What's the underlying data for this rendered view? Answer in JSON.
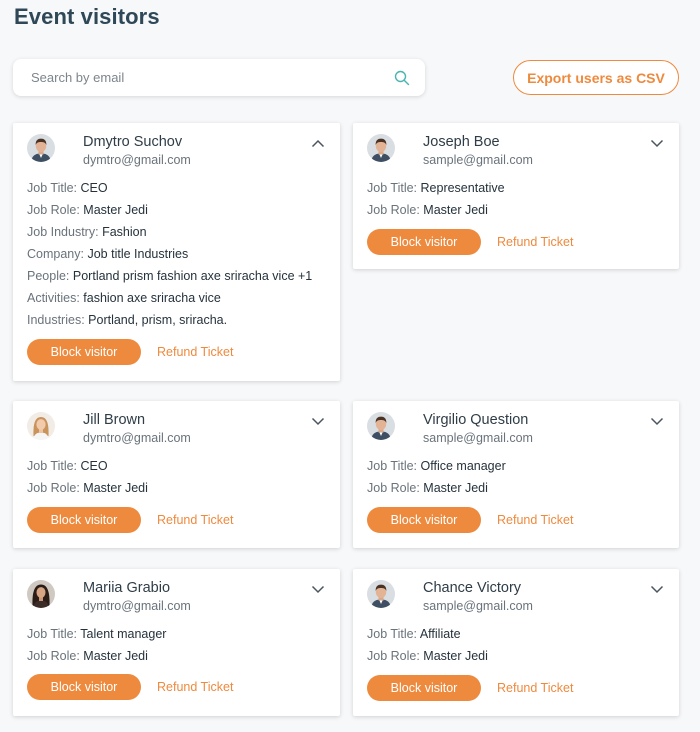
{
  "title": "Event visitors",
  "search": {
    "placeholder": "Search by email",
    "value": ""
  },
  "export_label": "Export users as CSV",
  "colors": {
    "accent": "#ee8a3e",
    "title": "#2f4858",
    "search_icon": "#4ab5b0"
  },
  "labels": {
    "job_title": "Job Title:",
    "job_role": "Job Role:",
    "job_industry": "Job Industry:",
    "company": "Company:",
    "people": "People:",
    "activities": "Activities:",
    "industries": "Industries:",
    "block": "Block visitor",
    "refund": "Refund Ticket"
  },
  "visitors": [
    {
      "name": "Dmytro Suchov",
      "email": "dymtro@gmail.com",
      "expanded": true,
      "avatar": "male-avatar-icon",
      "job_title": "CEO",
      "job_role": "Master Jedi",
      "job_industry": "Fashion",
      "company": "Job title Industries",
      "people": "Portland prism fashion axe sriracha vice +1",
      "activities": "fashion axe sriracha vice",
      "industries": "Portland, prism, sriracha."
    },
    {
      "name": "Joseph Boe",
      "email": "sample@gmail.com",
      "expanded": false,
      "avatar": "male-avatar-icon",
      "job_title": "Representative",
      "job_role": "Master Jedi"
    },
    {
      "name": "Jill Brown",
      "email": "dymtro@gmail.com",
      "expanded": false,
      "avatar": "female-avatar-icon",
      "job_title": "CEO",
      "job_role": "Master Jedi"
    },
    {
      "name": "Virgilio Question",
      "email": "sample@gmail.com",
      "expanded": false,
      "avatar": "male-avatar-icon",
      "job_title": "Office manager",
      "job_role": "Master Jedi"
    },
    {
      "name": "Mariia Grabio",
      "email": "dymtro@gmail.com",
      "expanded": false,
      "avatar": "female-avatar-icon",
      "job_title": "Talent manager",
      "job_role": "Master Jedi"
    },
    {
      "name": "Chance Victory",
      "email": "sample@gmail.com",
      "expanded": false,
      "avatar": "male-avatar-icon",
      "job_title": "Affiliate",
      "job_role": "Master Jedi"
    }
  ]
}
